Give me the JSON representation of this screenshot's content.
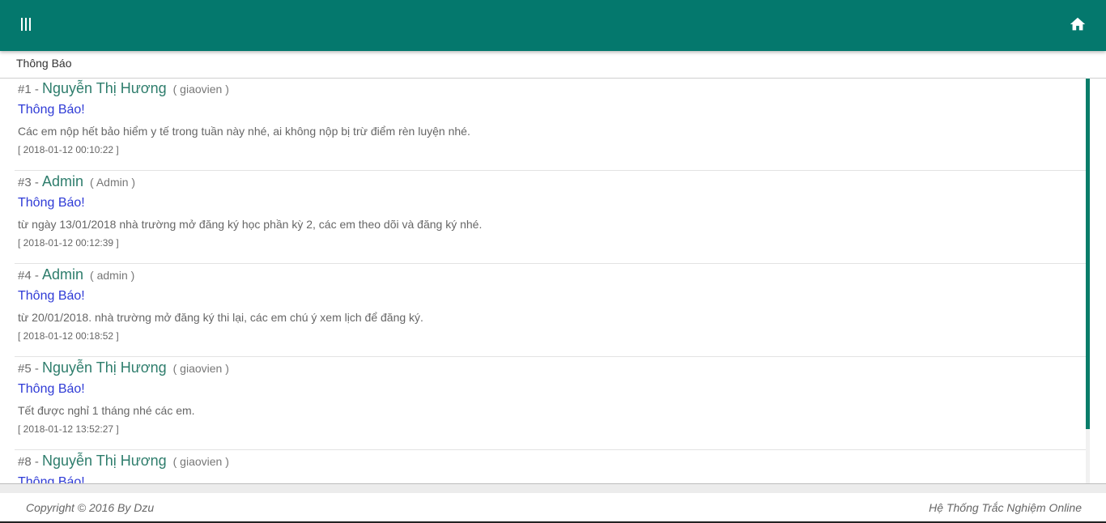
{
  "header": {
    "menu_icon": "menu-bars-icon",
    "home_icon": "home-icon",
    "bg_color": "#04786d"
  },
  "section": {
    "title": "Thông Báo"
  },
  "notifications": [
    {
      "num": "#1 - ",
      "author": "Nguyễn Thị Hương",
      "role": "( giaovien )",
      "title": "Thông Báo!",
      "content": "Các em nộp hết bảo hiểm y tế trong tuần này nhé, ai không nộp bị trừ điểm rèn luyện nhé.",
      "time": "[ 2018-01-12 00:10:22 ]"
    },
    {
      "num": "#3 - ",
      "author": "Admin",
      "role": "( Admin )",
      "title": "Thông Báo!",
      "content": "từ ngày 13/01/2018 nhà trường mở đăng ký học phần kỳ 2, các em theo dõi và đăng ký nhé.",
      "time": "[ 2018-01-12 00:12:39 ]"
    },
    {
      "num": "#4 - ",
      "author": "Admin",
      "role": "( admin )",
      "title": "Thông Báo!",
      "content": "từ 20/01/2018. nhà trường mở đăng ký thi lại, các em chú ý xem lịch để đăng ký.",
      "time": "[ 2018-01-12 00:18:52 ]"
    },
    {
      "num": "#5 - ",
      "author": "Nguyễn Thị Hương",
      "role": "( giaovien )",
      "title": "Thông Báo!",
      "content": "Tết được nghỉ 1 tháng nhé các em.",
      "time": "[ 2018-01-12 13:52:27 ]"
    },
    {
      "num": "#8 - ",
      "author": "Nguyễn Thị Hương",
      "role": "( giaovien )",
      "title": "Thông Báo!",
      "content": "",
      "time": ""
    }
  ],
  "footer": {
    "copyright": "Copyright © 2016 By Dzu",
    "system_name": "Hệ Thống Trắc Nghiệm Online"
  }
}
